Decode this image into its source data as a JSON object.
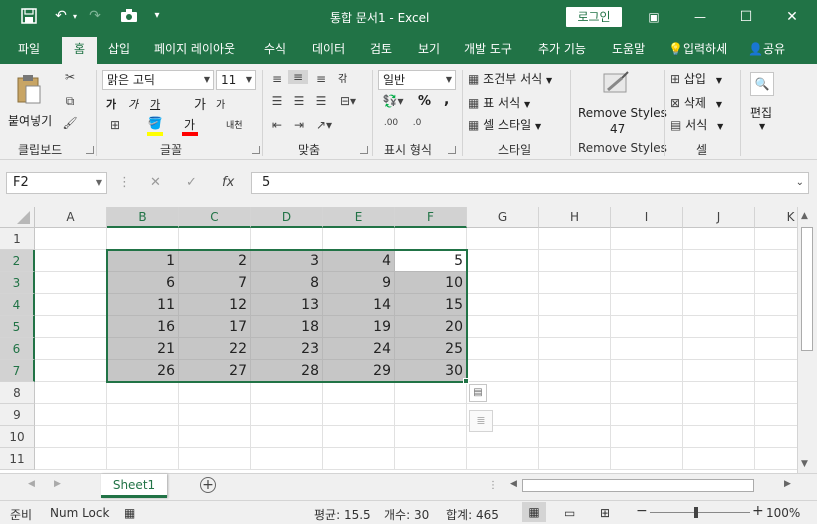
{
  "titlebar": {
    "title": "통합 문서1  -  Excel",
    "login_label": "로그인",
    "minimize_glyph": "—",
    "maximize_glyph": "☐",
    "close_glyph": "✕",
    "display_glyph": "▣"
  },
  "quick_access": {
    "save_icon": "floppy-icon",
    "undo_icon": "undo-icon",
    "redo_icon": "redo-icon",
    "camera_icon": "camera-icon",
    "customize_icon": "chevron-down-icon"
  },
  "tabs": [
    "파일",
    "홈",
    "삽입",
    "페이지 레이아웃",
    "수식",
    "데이터",
    "검토",
    "보기",
    "개발 도구",
    "추가 기능",
    "도움말"
  ],
  "tell_me": "입력하세",
  "share": "공유",
  "ribbon": {
    "clipboard": {
      "paste": "붙여넣기",
      "label": "클립보드"
    },
    "font": {
      "name": "맑은 고딕",
      "size": "11",
      "bold": "가",
      "italic": "가",
      "underline": "가",
      "grow": "가",
      "shrink": "가",
      "phonetic": "내천",
      "fill_color": "#ffff00",
      "font_color": "#ff0000",
      "label": "글꼴"
    },
    "alignment": {
      "wrap": "갂",
      "label": "맞춤"
    },
    "number": {
      "format": "일반",
      "percent": "%",
      "comma": ",",
      "label": "표시 형식"
    },
    "styles": {
      "conditional": "조건부 서식",
      "table": "표 서식",
      "cell": "셀 스타일",
      "label": "스타일"
    },
    "remove_styles": {
      "button": "Remove Styles",
      "count": "47",
      "label": "Remove Styles"
    },
    "cells": {
      "insert": "삽입",
      "delete": "삭제",
      "format": "서식",
      "label": "셀"
    },
    "editing": {
      "label": "편집"
    }
  },
  "formula_bar": {
    "name_box": "F2",
    "cancel": "✕",
    "enter": "✓",
    "fx": "fx",
    "value": "5"
  },
  "columns": [
    "A",
    "B",
    "C",
    "D",
    "E",
    "F",
    "G",
    "H",
    "I",
    "J",
    "K"
  ],
  "rows": [
    "1",
    "2",
    "3",
    "4",
    "5",
    "6",
    "7",
    "8",
    "9",
    "10",
    "11"
  ],
  "cells": [
    [
      "1",
      "2",
      "3",
      "4",
      "5"
    ],
    [
      "6",
      "7",
      "8",
      "9",
      "10"
    ],
    [
      "11",
      "12",
      "13",
      "14",
      "15"
    ],
    [
      "16",
      "17",
      "18",
      "19",
      "20"
    ],
    [
      "21",
      "22",
      "23",
      "24",
      "25"
    ],
    [
      "26",
      "27",
      "28",
      "29",
      "30"
    ]
  ],
  "sheet_tab": "Sheet1",
  "statusbar": {
    "mode": "준비",
    "numlock": "Num Lock",
    "average": "평균: 15.5",
    "count": "개수: 30",
    "sum": "합계: 465",
    "zoom": "100%",
    "zoom_out": "−",
    "zoom_in": "+"
  }
}
